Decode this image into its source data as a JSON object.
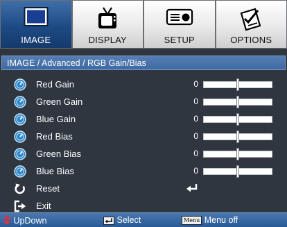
{
  "tabs": [
    {
      "label": "IMAGE",
      "icon": "monitor-icon",
      "active": true
    },
    {
      "label": "DISPLAY",
      "icon": "tv-icon",
      "active": false
    },
    {
      "label": "SETUP",
      "icon": "projector-icon",
      "active": false
    },
    {
      "label": "OPTIONS",
      "icon": "checklist-icon",
      "active": false
    }
  ],
  "breadcrumb": "IMAGE / Advanced / RGB Gain/Bias",
  "rows": [
    {
      "label": "Red Gain",
      "value": "0",
      "level": 0.5
    },
    {
      "label": "Green Gain",
      "value": "0",
      "level": 0.5
    },
    {
      "label": "Blue Gain",
      "value": "0",
      "level": 0.5
    },
    {
      "label": "Red Bias",
      "value": "0",
      "level": 0.5
    },
    {
      "label": "Green Bias",
      "value": "0",
      "level": 0.5
    },
    {
      "label": "Blue Bias",
      "value": "0",
      "level": 0.5
    }
  ],
  "reset_label": "Reset",
  "exit_label": "Exit",
  "hints": {
    "updown": "UpDown",
    "select": "Select",
    "menu_key": "Menu",
    "menu_off": "Menu off"
  },
  "colors": {
    "background": "#2f3640",
    "accent": "#3e6aa2",
    "gauge_icon": "#2f86c8",
    "updown_arrow": "#e0303a"
  }
}
